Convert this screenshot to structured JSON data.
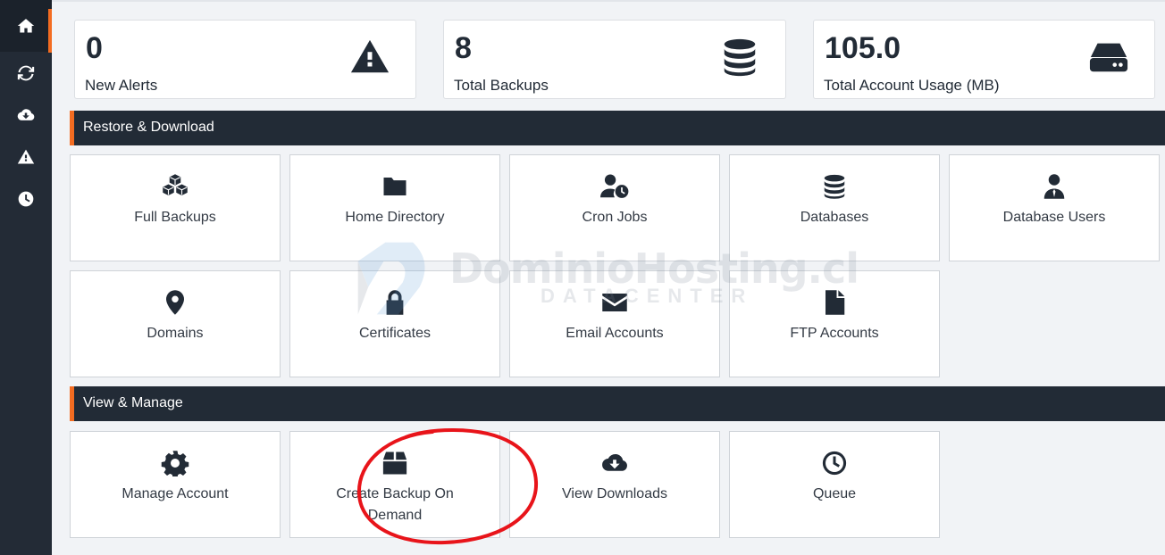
{
  "sidebar": {
    "items": [
      {
        "icon": "home-icon",
        "active": true
      },
      {
        "icon": "sync-icon",
        "active": false
      },
      {
        "icon": "cloud-download-icon",
        "active": false
      },
      {
        "icon": "warning-icon",
        "active": false
      },
      {
        "icon": "clock-icon",
        "active": false
      }
    ]
  },
  "stats": [
    {
      "value": "0",
      "label": "New Alerts",
      "icon": "warning-icon"
    },
    {
      "value": "8",
      "label": "Total Backups",
      "icon": "database-icon"
    },
    {
      "value": "105.0",
      "label": "Total Account Usage (MB)",
      "icon": "hard-drive-icon"
    }
  ],
  "sections": {
    "restore": "Restore & Download",
    "manage": "View & Manage"
  },
  "restore_tiles": [
    {
      "label": "Full Backups",
      "icon": "cubes-icon"
    },
    {
      "label": "Home Directory",
      "icon": "folder-icon"
    },
    {
      "label": "Cron Jobs",
      "icon": "user-clock-icon"
    },
    {
      "label": "Databases",
      "icon": "database-icon"
    },
    {
      "label": "Database Users",
      "icon": "user-tie-icon"
    },
    {
      "label": "Domains",
      "icon": "map-marker-icon"
    },
    {
      "label": "Certificates",
      "icon": "lock-icon"
    },
    {
      "label": "Email Accounts",
      "icon": "envelope-icon"
    },
    {
      "label": "FTP Accounts",
      "icon": "file-icon"
    }
  ],
  "manage_tiles": [
    {
      "label": "Manage Account",
      "icon": "gear-icon"
    },
    {
      "label": "Create Backup On Demand",
      "icon": "box-icon"
    },
    {
      "label": "View Downloads",
      "icon": "cloud-download-icon"
    },
    {
      "label": "Queue",
      "icon": "clock-icon"
    }
  ],
  "watermark": {
    "brand": "DominioHosting.cl",
    "sub": "DATACENTER"
  },
  "colors": {
    "sidebar": "#232b36",
    "accent": "#f36c21",
    "header": "#222b36",
    "annotation": "#e8141a"
  }
}
